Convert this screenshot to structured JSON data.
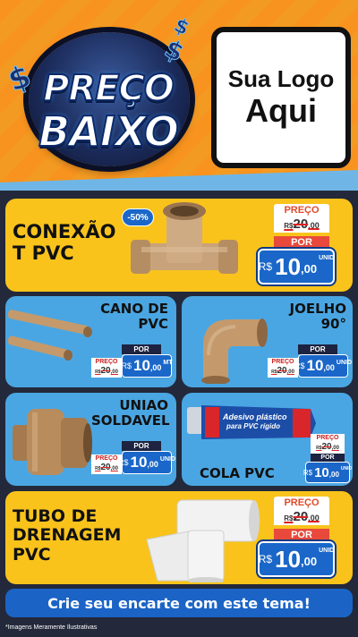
{
  "header": {
    "badge_line1": "PREÇO",
    "badge_line2": "BAIXO",
    "dollar_sign": "$",
    "logo_line1": "Sua Logo",
    "logo_line2": "Aqui"
  },
  "products": [
    {
      "title": "CONEXÃO\nT PVC",
      "discount": "-50%",
      "price_label": "PREÇO",
      "old_prefix": "R$",
      "old_int": "20",
      "old_cents": ",00",
      "por_label": "POR",
      "currency": "R$",
      "price_int": "10",
      "price_cents": ",00",
      "unit": "UNID"
    },
    {
      "title": "CANO DE\nPVC",
      "price_label": "PREÇO",
      "old_prefix": "R$",
      "old_int": "20",
      "old_cents": ",00",
      "por_label": "POR",
      "currency": "R$",
      "price_int": "10",
      "price_cents": ",00",
      "unit": "MT"
    },
    {
      "title": "JOELHO\n90°",
      "price_label": "PREÇO",
      "old_prefix": "R$",
      "old_int": "20",
      "old_cents": ",00",
      "por_label": "POR",
      "currency": "R$",
      "price_int": "10",
      "price_cents": ",00",
      "unit": "UNID"
    },
    {
      "title": "UNIAO\nSOLDAVEL",
      "price_label": "PREÇO",
      "old_prefix": "R$",
      "old_int": "20",
      "old_cents": ",00",
      "por_label": "POR",
      "currency": "R$",
      "price_int": "10",
      "price_cents": ",00",
      "unit": "UNID"
    },
    {
      "title": "COLA PVC",
      "tube_label1": "Adesivo plástico",
      "tube_label2": "para PVC rígido",
      "price_label": "PREÇO",
      "old_prefix": "R$",
      "old_int": "20",
      "old_cents": ",00",
      "por_label": "POR",
      "currency": "R$",
      "price_int": "10",
      "price_cents": ",00",
      "unit": "UNID"
    },
    {
      "title": "TUBO DE\nDRENAGEM\nPVC",
      "price_label": "PREÇO",
      "old_prefix": "R$",
      "old_int": "20",
      "old_cents": ",00",
      "por_label": "POR",
      "currency": "R$",
      "price_int": "10",
      "price_cents": ",00",
      "unit": "UNID"
    }
  ],
  "cta": "Crie seu encarte com este tema!",
  "disclaimer": "*Imagens Meramente Ilustrativas",
  "colors": {
    "orange": "#f7931e",
    "yellow": "#f9c31c",
    "blue_card": "#4aa6e2",
    "price_blue": "#1a67c9",
    "red": "#e8493a"
  }
}
